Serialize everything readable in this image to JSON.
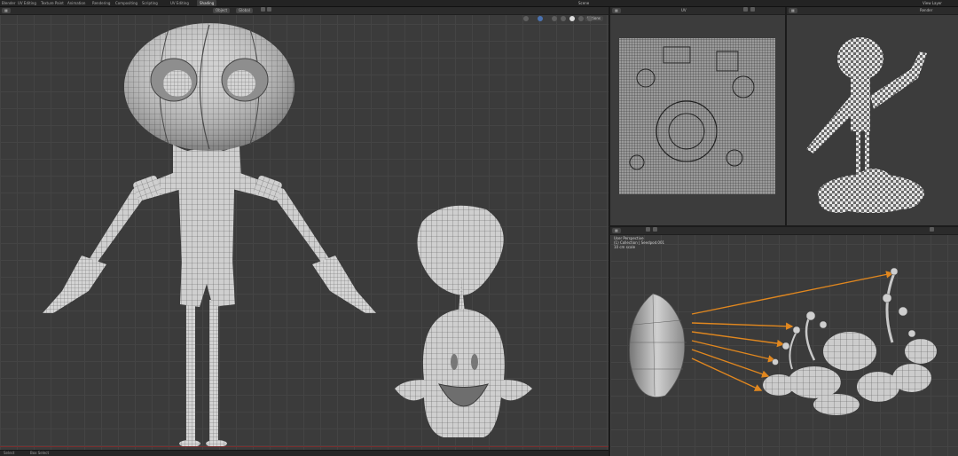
{
  "topbar": {
    "workspace_tabs": [
      "Blender",
      "UV Editing",
      "Texture Paint",
      "Animation",
      "Rendering",
      "Compositing",
      "Scripting",
      "UV Editing",
      "Shading"
    ],
    "active_tab": "Shading",
    "scene": "Scene",
    "view_layer": "View Layer"
  },
  "main_viewport": {
    "header": {
      "mode": "Object",
      "view": "Global",
      "options": "Options"
    }
  },
  "image_editor": {
    "header": {
      "title": "UV"
    }
  },
  "render_view": {
    "header": {
      "title": "Render"
    }
  },
  "bottom_view": {
    "info": [
      "User Perspective",
      "(1) Collection | Seedpod.001",
      "10 cm scale"
    ]
  },
  "statusbar": {
    "left": "Select",
    "middle": "Box Select"
  },
  "colors": {
    "arrow": "#e0871f",
    "mesh_fill": "#d2d2d2",
    "wire": "#5a5a5a",
    "viewport_bg": "#3b3b3b"
  }
}
